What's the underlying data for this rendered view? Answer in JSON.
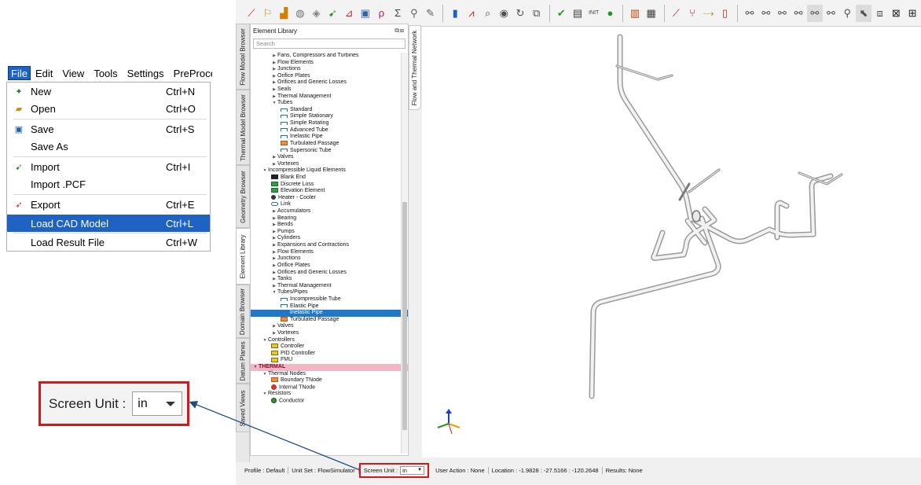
{
  "file_menu": {
    "menubar": [
      "File",
      "Edit",
      "View",
      "Tools",
      "Settings",
      "PreProce"
    ],
    "items": [
      {
        "label": "New",
        "shortcut": "Ctrl+N",
        "icon": "new-icon"
      },
      {
        "label": "Open",
        "shortcut": "Ctrl+O",
        "icon": "open-icon"
      },
      {
        "label": "Save",
        "shortcut": "Ctrl+S",
        "icon": "save-icon"
      },
      {
        "label": "Save As",
        "shortcut": "",
        "icon": ""
      },
      {
        "label": "Import",
        "shortcut": "Ctrl+I",
        "icon": "import-icon"
      },
      {
        "label": "Import .PCF",
        "shortcut": "",
        "icon": ""
      },
      {
        "label": "Export",
        "shortcut": "Ctrl+E",
        "icon": "export-icon"
      },
      {
        "label": "Load CAD Model",
        "shortcut": "Ctrl+L",
        "icon": ""
      },
      {
        "label": "Load Result File",
        "shortcut": "Ctrl+W",
        "icon": ""
      }
    ],
    "highlighted_item": "Load CAD Model"
  },
  "vertical_tabs": [
    "Flow Model Browser",
    "Thermal Model Browser",
    "Geometry Browser",
    "Element Library",
    "Domain Browser",
    "Datum Planes",
    "Saved Views"
  ],
  "active_tab": "Element Library",
  "network_tab": "Flow and Thermal Network",
  "library": {
    "title": "Element Library",
    "search_placeholder": "Search",
    "tree": [
      {
        "label": "Fans, Compressors and Turbines",
        "level": 2,
        "arrow": "collapsed"
      },
      {
        "label": "Flow Elements",
        "level": 2,
        "arrow": "collapsed"
      },
      {
        "label": "Junctions",
        "level": 2,
        "arrow": "collapsed"
      },
      {
        "label": "Orifice Plates",
        "level": 2,
        "arrow": "collapsed"
      },
      {
        "label": "Orifices and Generic Losses",
        "level": 2,
        "arrow": "collapsed"
      },
      {
        "label": "Seals",
        "level": 2,
        "arrow": "collapsed"
      },
      {
        "label": "Thermal Management",
        "level": 2,
        "arrow": "collapsed"
      },
      {
        "label": "Tubes",
        "level": 2,
        "arrow": "expanded"
      },
      {
        "label": "Standard",
        "level": 3,
        "icon": "tube"
      },
      {
        "label": "Simple Stationary",
        "level": 3,
        "icon": "tube"
      },
      {
        "label": "Simple Rotating",
        "level": 3,
        "icon": "tube"
      },
      {
        "label": "Advanced Tube",
        "level": 3,
        "icon": "tube"
      },
      {
        "label": "Inelastic Pipe",
        "level": 3,
        "icon": "tube"
      },
      {
        "label": "Turbulated Passage",
        "level": 3,
        "icon": "orange"
      },
      {
        "label": "Supersonic Tube",
        "level": 3,
        "icon": "tube"
      },
      {
        "label": "Valves",
        "level": 2,
        "arrow": "collapsed"
      },
      {
        "label": "Vortexes",
        "level": 2,
        "arrow": "collapsed"
      },
      {
        "label": "Incompressible Liquid Elements",
        "level": 1,
        "arrow": "expanded"
      },
      {
        "label": "Blank End",
        "level": 2,
        "icon": "black"
      },
      {
        "label": "Discrete Loss",
        "level": 2,
        "icon": "green"
      },
      {
        "label": "Elevation Element",
        "level": 2,
        "icon": "green"
      },
      {
        "label": "Heater - Cooler",
        "level": 2,
        "icon": "dot"
      },
      {
        "label": "Link",
        "level": 2,
        "icon": "link"
      },
      {
        "label": "Accumulators",
        "level": 2,
        "arrow": "collapsed"
      },
      {
        "label": "Bearing",
        "level": 2,
        "arrow": "collapsed"
      },
      {
        "label": "Bends",
        "level": 2,
        "arrow": "collapsed"
      },
      {
        "label": "Pumps",
        "level": 2,
        "arrow": "collapsed"
      },
      {
        "label": "Cylinders",
        "level": 2,
        "arrow": "collapsed"
      },
      {
        "label": "Expansions and Contractions",
        "level": 2,
        "arrow": "collapsed"
      },
      {
        "label": "Flow Elements",
        "level": 2,
        "arrow": "collapsed"
      },
      {
        "label": "Junctions",
        "level": 2,
        "arrow": "collapsed"
      },
      {
        "label": "Orifice Plates",
        "level": 2,
        "arrow": "collapsed"
      },
      {
        "label": "Orifices and Generic Losses",
        "level": 2,
        "arrow": "collapsed"
      },
      {
        "label": "Tanks",
        "level": 2,
        "arrow": "collapsed"
      },
      {
        "label": "Thermal Management",
        "level": 2,
        "arrow": "collapsed"
      },
      {
        "label": "Tubes/Pipes",
        "level": 2,
        "arrow": "expanded"
      },
      {
        "label": "Incompressible Tube",
        "level": 3,
        "icon": "tube"
      },
      {
        "label": "Elastic Pipe",
        "level": 3,
        "icon": "tube"
      },
      {
        "label": "Inelastic Pipe",
        "level": 3,
        "icon": "tube",
        "selected": true
      },
      {
        "label": "Turbulated Passage",
        "level": 3,
        "icon": "orange"
      },
      {
        "label": "Valves",
        "level": 2,
        "arrow": "collapsed"
      },
      {
        "label": "Vortexes",
        "level": 2,
        "arrow": "collapsed"
      },
      {
        "label": "Controllers",
        "level": 1,
        "arrow": "expanded"
      },
      {
        "label": "Controller",
        "level": 2,
        "icon": "yellow"
      },
      {
        "label": "PID Controller",
        "level": 2,
        "icon": "yellow"
      },
      {
        "label": "FMU",
        "level": 2,
        "icon": "yellow"
      },
      {
        "label": "THERMAL",
        "level": 0,
        "arrow": "expanded",
        "highlight": true
      },
      {
        "label": "Thermal Nodes",
        "level": 1,
        "arrow": "expanded"
      },
      {
        "label": "Boundary TNode",
        "level": 2,
        "icon": "orange"
      },
      {
        "label": "Internal TNode",
        "level": 2,
        "icon": "red"
      },
      {
        "label": "Resistors",
        "level": 1,
        "arrow": "expanded"
      },
      {
        "label": "Conductor",
        "level": 2,
        "icon": "cond"
      }
    ]
  },
  "status_bar": {
    "profile": "Profile : Default",
    "unit_set": "Unit Set : FlowSimulator",
    "screen_unit_label": "Screen Unit :",
    "screen_unit_value": "in",
    "user_action": "User Action : None",
    "location": "Location : -1.9828 : -27.5166 : -120.2648",
    "results": "Results: None"
  },
  "callout": {
    "label": "Screen Unit :",
    "value": "in"
  },
  "colors": {
    "highlight_blue": "#1e63c4",
    "tree_selected": "#1f78c8",
    "callout_red": "#d81818",
    "thermal_pink": "#f4b6c2"
  }
}
